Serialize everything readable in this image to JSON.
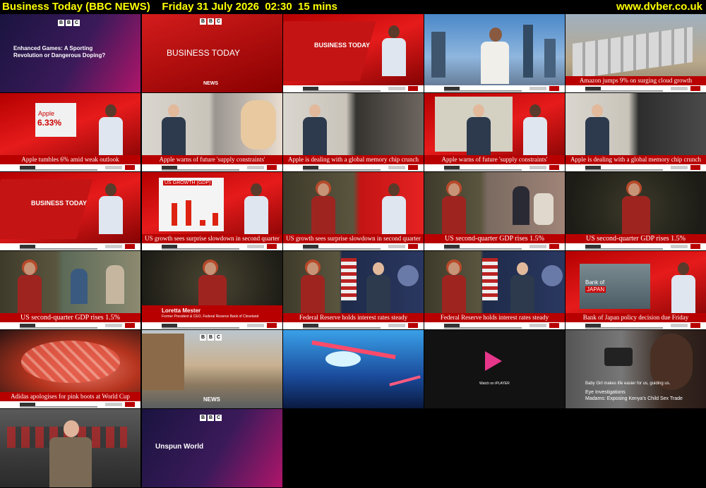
{
  "header": {
    "title": "Business Today (BBC NEWS)    Friday 31 July 2026  02:30  15 mins",
    "site": "www.dvber.co.uk"
  },
  "tiles": [
    {
      "caption": ""
    },
    {
      "caption": ""
    },
    {
      "caption": ""
    },
    {
      "caption": ""
    },
    {
      "caption": "Amazon jumps 9% on surging cloud growth"
    },
    {
      "caption": "Apple tumbles 6% amid weak outlook"
    },
    {
      "caption": "Apple warns of future 'supply constraints'"
    },
    {
      "caption": "Apple is dealing with a global memory chip crunch"
    },
    {
      "caption": "Apple warns of future 'supply constraints'"
    },
    {
      "caption": "Apple is dealing with a global memory chip crunch"
    },
    {
      "caption": ""
    },
    {
      "caption": "US growth sees surprise slowdown in second quarter"
    },
    {
      "caption": "US growth sees surprise slowdown in second quarter"
    },
    {
      "caption": "US second-quarter GDP rises 1.5%"
    },
    {
      "caption": "US second-quarter GDP rises 1.5%"
    },
    {
      "caption": "US second-quarter GDP rises 1.5%"
    },
    {
      "caption": ""
    },
    {
      "caption": "Federal Reserve holds interest rates steady"
    },
    {
      "caption": "Federal Reserve holds interest rates steady"
    },
    {
      "caption": "Bank of Japan policy decision due Friday"
    },
    {
      "caption": "Adidas apologises for pink boots at World Cup"
    }
  ],
  "text": {
    "enhanced_games": "Enhanced Games: A Sporting Revolution or Dangerous Doping?",
    "business_today": "BUSINESS TODAY",
    "news": "NEWS",
    "business_today_studio": "BUSINESS TODAY",
    "apple_card_label": "Apple",
    "apple_pct": "6.33%",
    "us_growth_chart": "US GROWTH (GDP)",
    "bank_of_japan_1": "Bank of",
    "bank_of_japan_2": "JAPAN",
    "loretta_name": "Loretta Mester",
    "loretta_title": "Former President & CEO, Federal Reserve Bank of Cleveland",
    "watch_on": "Watch on iPLAYER",
    "eye_line1": "Baby Girl makes life easier for us, guiding us.",
    "eye_line2": "Eye Investigations",
    "eye_line3": "Madams: Exposing Kenya's Child Sex Trade",
    "unspun": "Unspun World",
    "news2": "NEWS"
  },
  "bbc_letters": [
    "B",
    "B",
    "C"
  ],
  "colors": {
    "header_text": "#ffff00",
    "bbc_red": "#b80000"
  }
}
